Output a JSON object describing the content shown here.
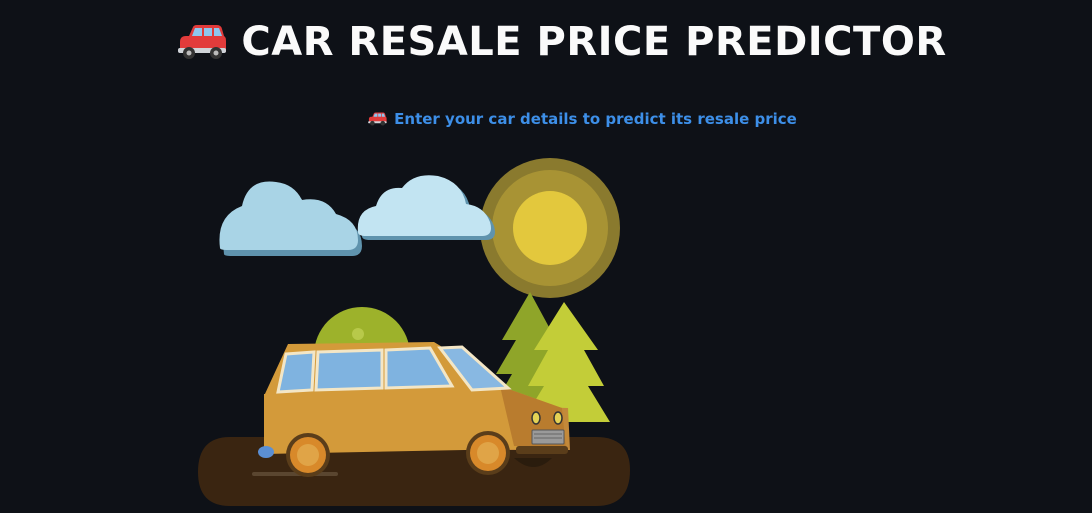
{
  "header": {
    "title": "CAR RESALE PRICE PREDICTOR",
    "title_icon": "red-car-emoji-icon"
  },
  "subheader": {
    "text": "Enter your car details to predict its resale price",
    "icon": "red-car-emoji-icon"
  },
  "illustration": {
    "description_icon": "car-landscape-illustration",
    "colors": {
      "background": "#0e1117",
      "title": "#fafafa",
      "subtitle": "#3d8fe8",
      "car_body": "#d39a3a",
      "road": "#3a2511",
      "sun": "#e3c83d",
      "cloud": "#a9d4e6",
      "tree": "#b7c934"
    }
  }
}
